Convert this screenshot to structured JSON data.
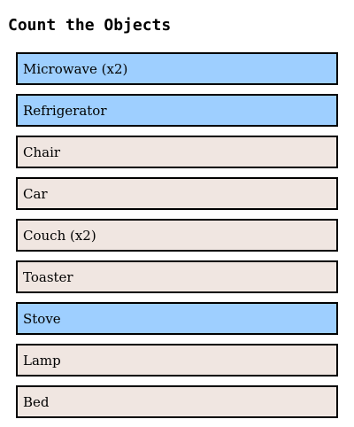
{
  "title": "Count the Objects",
  "colors": {
    "selected": "#9ecfff",
    "unselected": "#f0e6e1",
    "border": "#000000"
  },
  "items": [
    {
      "label": "Microwave (x2)",
      "selected": true
    },
    {
      "label": "Refrigerator",
      "selected": true
    },
    {
      "label": "Chair",
      "selected": false
    },
    {
      "label": "Car",
      "selected": false
    },
    {
      "label": "Couch (x2)",
      "selected": false
    },
    {
      "label": "Toaster",
      "selected": false
    },
    {
      "label": "Stove",
      "selected": true
    },
    {
      "label": "Lamp",
      "selected": false
    },
    {
      "label": "Bed",
      "selected": false
    }
  ]
}
